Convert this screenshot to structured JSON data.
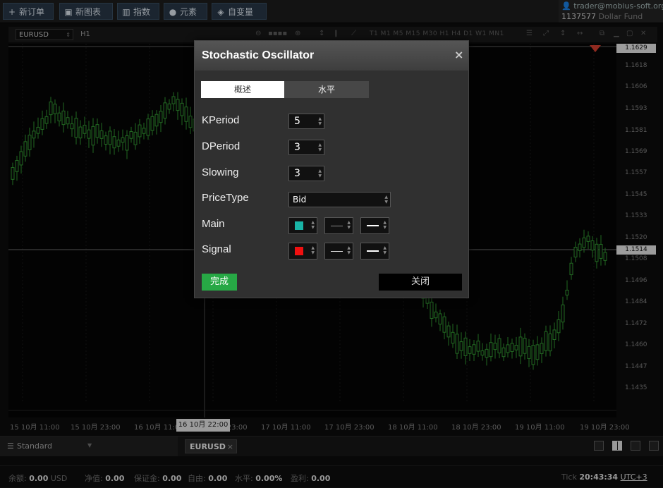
{
  "colors": {
    "candle_green": "#2e8b2e",
    "main_color": "#19b4a6",
    "signal_color": "#f01010",
    "ok_button": "#27a845"
  },
  "toolbar": {
    "buttons": [
      {
        "icon": "plus-icon",
        "glyph": "+",
        "label": "新订单"
      },
      {
        "icon": "chart-window-icon",
        "glyph": "▣",
        "label": "新图表"
      },
      {
        "icon": "indicator-icon",
        "glyph": "▥",
        "label": "指数"
      },
      {
        "icon": "element-icon",
        "glyph": "●",
        "label": "元素"
      },
      {
        "icon": "variable-icon",
        "glyph": "◈",
        "label": "自变量"
      }
    ]
  },
  "account": {
    "user": "trader@mobius-soft.org",
    "number": "1137577",
    "fund": "Dollar Fund"
  },
  "chart_toolbar": {
    "symbol": "EURUSD",
    "timeframe": "H1",
    "periods": "T1 M1 M5 M15 M30 H1 H4 D1 W1 MN1"
  },
  "price_axis": {
    "top_badge": "1.1629",
    "current_badge": "1.1514",
    "labels": [
      "1.1618",
      "1.1606",
      "1.1593",
      "1.1581",
      "1.1569",
      "1.1557",
      "1.1545",
      "1.1533",
      "1.1520",
      "1.1508",
      "1.1496",
      "1.1484",
      "1.1472",
      "1.1460",
      "1.1447",
      "1.1435"
    ]
  },
  "time_axis": {
    "labels": [
      "15 10月 11:00",
      "15 10月 23:00",
      "16 10月 11:00",
      "16 10月 23:00",
      "17 10月 11:00",
      "17 10月 23:00",
      "18 10月 11:00",
      "18 10月 23:00",
      "19 10月 11:00",
      "19 10月 23:00"
    ],
    "cursor_badge": "16 10月 22:00"
  },
  "dialog": {
    "title": "Stochastic Oscillator",
    "close_glyph": "×",
    "tabs": [
      "概述",
      "水平"
    ],
    "fields": {
      "kperiod": {
        "label": "KPeriod",
        "value": "5"
      },
      "dperiod": {
        "label": "DPeriod",
        "value": "3"
      },
      "slowing": {
        "label": "Slowing",
        "value": "3"
      },
      "price_type": {
        "label": "PriceType",
        "value": "Bid"
      },
      "main": {
        "label": "Main"
      },
      "signal": {
        "label": "Signal"
      }
    },
    "ok_label": "完成",
    "close_label": "关闭"
  },
  "bottom": {
    "layout": "Standard",
    "symbol_tab": "EURUSD",
    "tab_close": "×"
  },
  "status": {
    "balance_label": "余额:",
    "balance_value": "0.00",
    "balance_currency": "USD",
    "equity_label": "净值:",
    "equity_value": "0.00",
    "margin_label": "保证金:",
    "margin_value": "0.00",
    "free_label": "自由:",
    "free_value": "0.00",
    "level_label": "水平:",
    "level_value": "0.00%",
    "profit_label": "盈利:",
    "profit_value": "0.00",
    "tick_label": "Tick",
    "time": "20:43:34",
    "tz": "UTC+3"
  }
}
